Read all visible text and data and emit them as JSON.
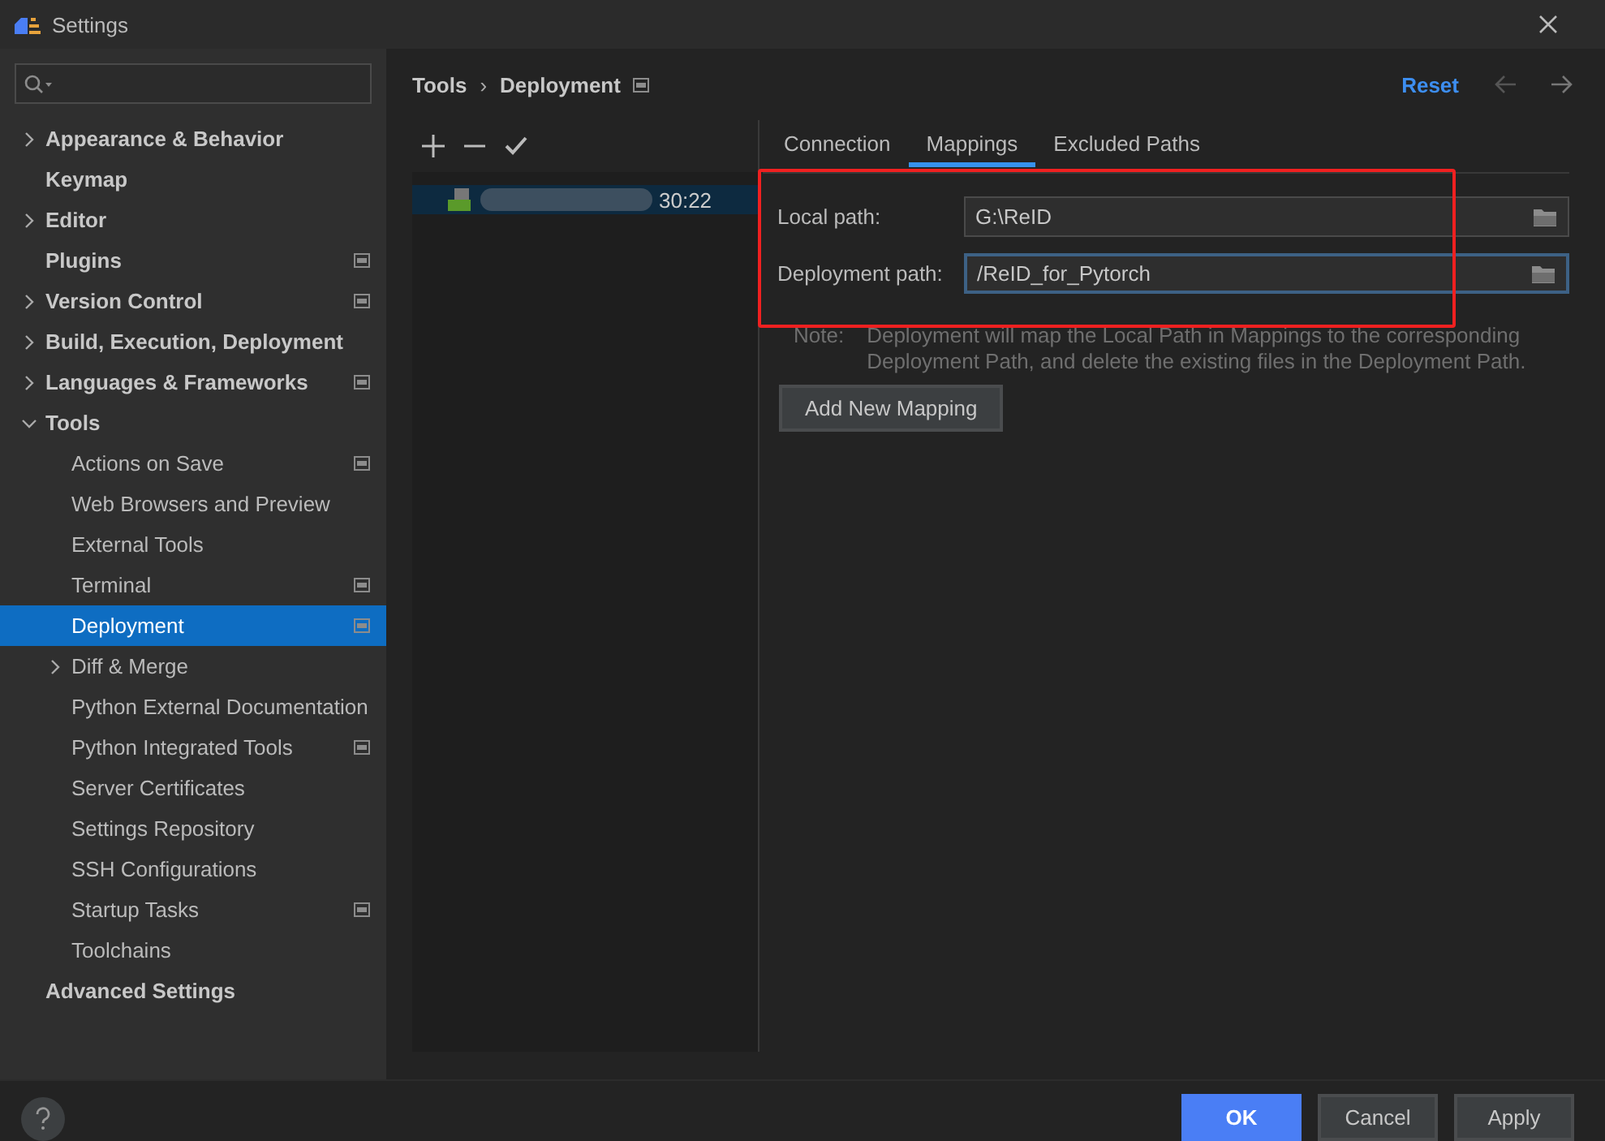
{
  "window": {
    "title": "Settings"
  },
  "sidebar": {
    "items": [
      {
        "label": "Appearance & Behavior",
        "expanded": false,
        "scoped": false,
        "selected": false
      },
      {
        "label": "Keymap",
        "scoped": false,
        "selected": false
      },
      {
        "label": "Editor",
        "expanded": false,
        "scoped": false,
        "selected": false
      },
      {
        "label": "Plugins",
        "scoped": true,
        "selected": false
      },
      {
        "label": "Version Control",
        "expanded": false,
        "scoped": true,
        "selected": false
      },
      {
        "label": "Build, Execution, Deployment",
        "expanded": false,
        "scoped": false,
        "selected": false
      },
      {
        "label": "Languages & Frameworks",
        "expanded": false,
        "scoped": true,
        "selected": false
      },
      {
        "label": "Tools",
        "expanded": true,
        "scoped": false,
        "selected": false,
        "children": [
          {
            "label": "Actions on Save",
            "scoped": true,
            "selected": false
          },
          {
            "label": "Web Browsers and Preview",
            "scoped": false,
            "selected": false
          },
          {
            "label": "External Tools",
            "scoped": false,
            "selected": false
          },
          {
            "label": "Terminal",
            "scoped": true,
            "selected": false
          },
          {
            "label": "Deployment",
            "scoped": true,
            "selected": true
          },
          {
            "label": "Diff & Merge",
            "expanded": false,
            "scoped": false,
            "selected": false
          },
          {
            "label": "Python External Documentation",
            "scoped": false,
            "selected": false
          },
          {
            "label": "Python Integrated Tools",
            "scoped": true,
            "selected": false
          },
          {
            "label": "Server Certificates",
            "scoped": false,
            "selected": false
          },
          {
            "label": "Settings Repository",
            "scoped": false,
            "selected": false
          },
          {
            "label": "SSH Configurations",
            "scoped": false,
            "selected": false
          },
          {
            "label": "Startup Tasks",
            "scoped": true,
            "selected": false
          },
          {
            "label": "Toolchains",
            "scoped": false,
            "selected": false
          }
        ]
      },
      {
        "label": "Advanced Settings",
        "scoped": false,
        "selected": false
      }
    ]
  },
  "breadcrumb": [
    "Tools",
    "›",
    "Deployment"
  ],
  "reset": "Reset",
  "servers": [
    {
      "label": "30:22",
      "selected": true
    }
  ],
  "tabs": [
    {
      "label": "Connection",
      "selected": false
    },
    {
      "label": "Mappings",
      "selected": true
    },
    {
      "label": "Excluded Paths",
      "selected": false
    }
  ],
  "fields": [
    {
      "label": "Local path:",
      "value": "G:\\ReID",
      "focused": false
    },
    {
      "label": "Deployment path:",
      "value": "/ReID_for_Pytorch",
      "focused": true
    }
  ],
  "note": {
    "label": "Note:",
    "text": "Deployment will map the Local Path in Mappings to the corresponding Deployment Path, and delete the existing files in the Deployment Path."
  },
  "add_button": "Add New Mapping",
  "buttons": [
    {
      "label": "OK",
      "kind": "primary"
    },
    {
      "label": "Cancel",
      "kind": "normal"
    },
    {
      "label": "Apply",
      "kind": "normal"
    }
  ]
}
